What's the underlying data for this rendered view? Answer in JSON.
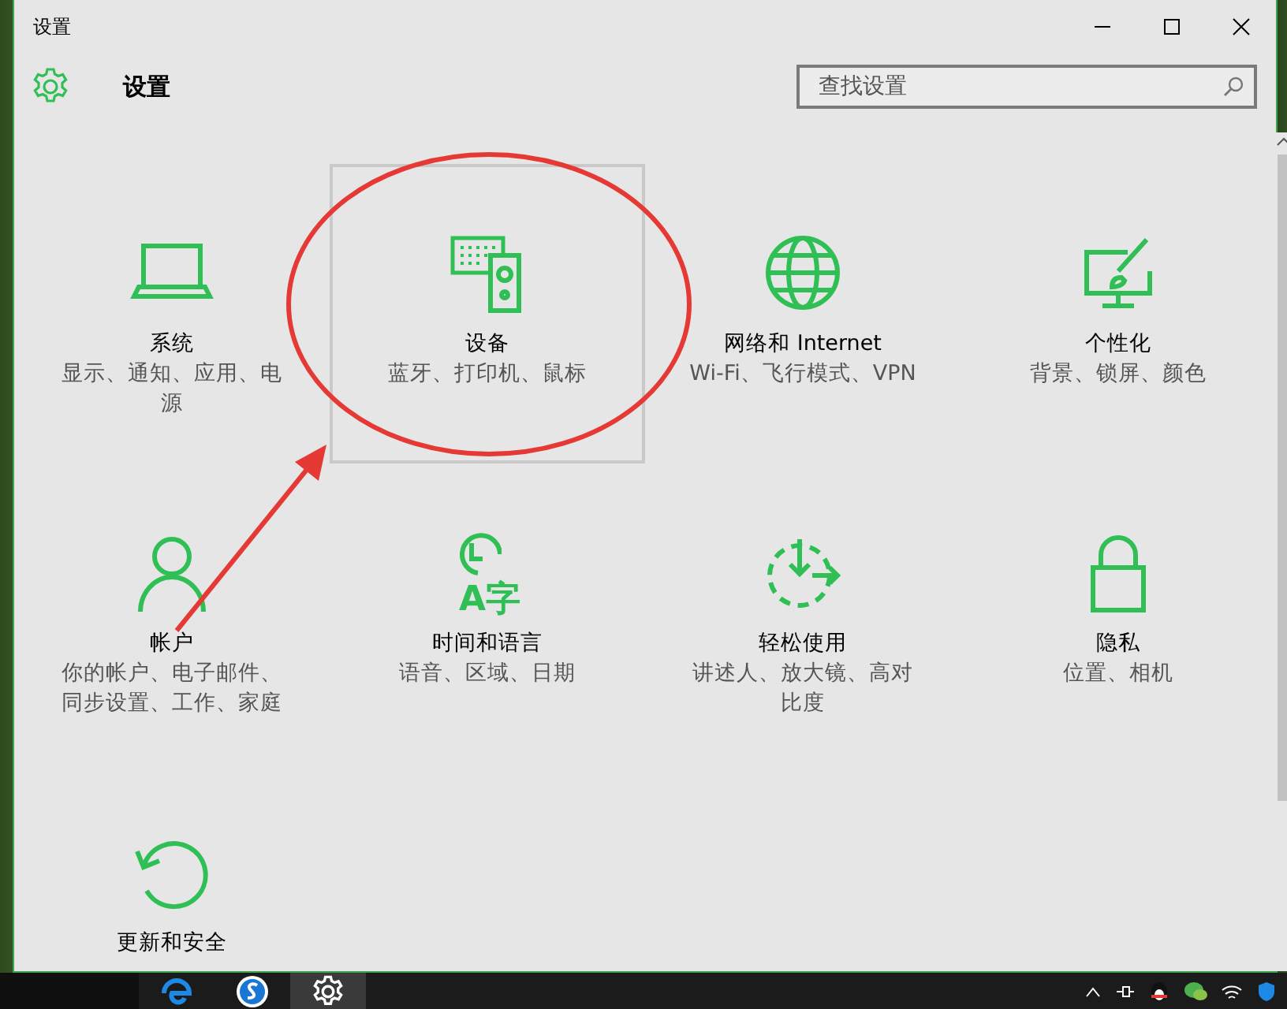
{
  "window": {
    "title": "设置"
  },
  "header": {
    "title": "设置"
  },
  "search": {
    "placeholder": "查找设置"
  },
  "tiles": [
    {
      "kind": "system",
      "label": "系统",
      "description": [
        "显示、通知、应用、电",
        "源"
      ],
      "highlighted": false
    },
    {
      "kind": "devices",
      "label": "设备",
      "description": [
        "蓝牙、打印机、鼠标"
      ],
      "highlighted": true
    },
    {
      "kind": "network",
      "label": "网络和 Internet",
      "description": [
        "Wi-Fi、飞行模式、VPN"
      ],
      "highlighted": false
    },
    {
      "kind": "personalize",
      "label": "个性化",
      "description": [
        "背景、锁屏、颜色"
      ],
      "highlighted": false
    },
    {
      "kind": "accounts",
      "label": "帐户",
      "description": [
        "你的帐户、电子邮件、",
        "同步设置、工作、家庭"
      ],
      "highlighted": false
    },
    {
      "kind": "time",
      "icon_text": "A字",
      "label": "时间和语言",
      "description": [
        "语音、区域、日期"
      ],
      "highlighted": false
    },
    {
      "kind": "ease",
      "label": "轻松使用",
      "description": [
        "讲述人、放大镜、高对",
        "比度"
      ],
      "highlighted": false
    },
    {
      "kind": "privacy",
      "label": "隐私",
      "description": [
        "位置、相机"
      ],
      "highlighted": false
    },
    {
      "kind": "update",
      "label": "更新和安全",
      "highlighted": false
    }
  ],
  "taskbar": {
    "apps": [
      {
        "kind": "edge",
        "selected": false
      },
      {
        "kind": "browser",
        "selected": false
      },
      {
        "kind": "settings",
        "selected": true
      }
    ]
  }
}
